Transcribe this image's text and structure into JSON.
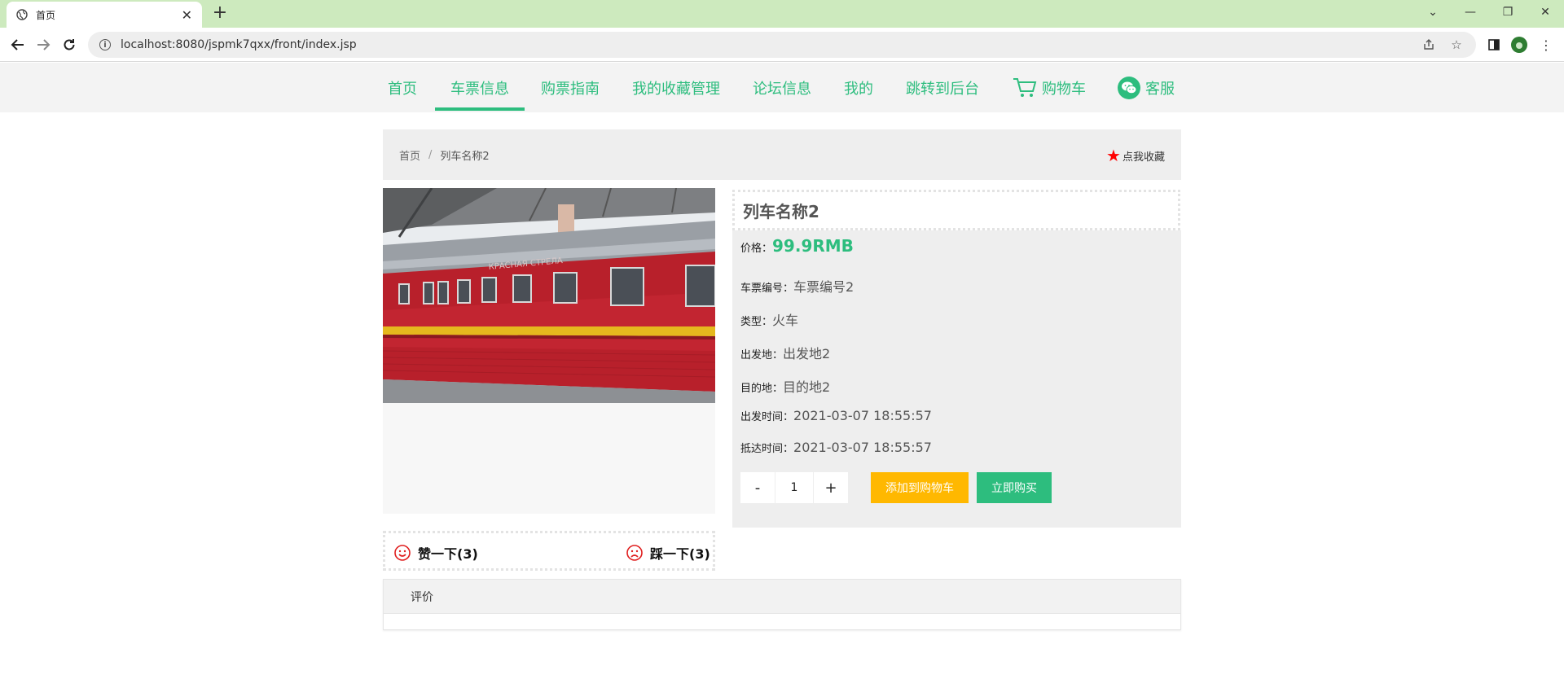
{
  "browser": {
    "tab_title": "首页",
    "new_tab": "+",
    "url": "localhost:8080/jspmk7qxx/front/index.jsp"
  },
  "nav": {
    "items": [
      {
        "label": "首页"
      },
      {
        "label": "车票信息"
      },
      {
        "label": "购票指南"
      },
      {
        "label": "我的收藏管理"
      },
      {
        "label": "论坛信息"
      },
      {
        "label": "我的"
      },
      {
        "label": "跳转到后台"
      },
      {
        "label": "购物车"
      },
      {
        "label": "客服"
      }
    ],
    "active_index": 1
  },
  "breadcrumb": {
    "home": "首页",
    "separator": "/",
    "current": "列车名称2"
  },
  "favorite": {
    "label": "点我收藏"
  },
  "product": {
    "name": "列车名称2",
    "price_label": "价格：",
    "price": "99.9RMB",
    "fields": [
      {
        "key": "车票编号：",
        "value": "车票编号2"
      },
      {
        "key": "类型：",
        "value": "火车"
      },
      {
        "key": "出发地：",
        "value": "出发地2"
      },
      {
        "key": "目的地：",
        "value": "目的地2"
      },
      {
        "key": "出发时间：",
        "value": "2021-03-07 18:55:57"
      },
      {
        "key": "抵达时间：",
        "value": "2021-03-07 18:55:57"
      }
    ],
    "quantity": "1",
    "minus": "-",
    "plus": "+",
    "add_to_cart": "添加到购物车",
    "buy_now": "立即购买"
  },
  "votes": {
    "like": "赞一下(3)",
    "dislike": "踩一下(3)"
  },
  "comments": {
    "title": "评价"
  },
  "colors": {
    "accent": "#2dbd7e",
    "cart_button": "#ffb800",
    "star": "#ff0000",
    "tabbar": "#cdeabe"
  }
}
